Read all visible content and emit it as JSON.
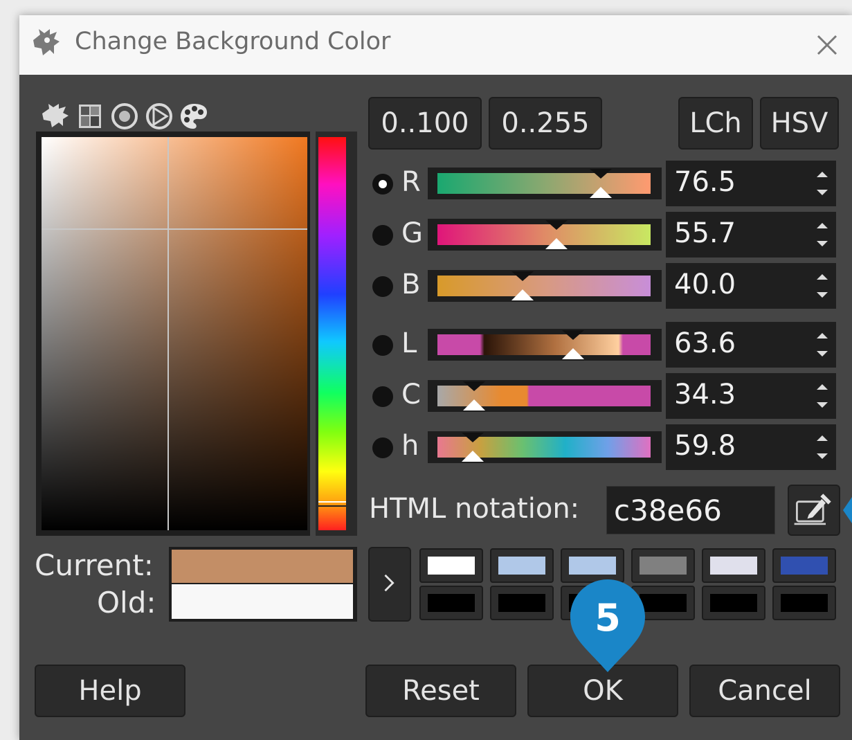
{
  "window": {
    "title": "Change Background Color",
    "close_icon": "close-icon",
    "app_icon": "gimp-icon"
  },
  "selector_tabs": [
    "gimp-selector-icon",
    "cmyk-selector-icon",
    "watercolor-selector-icon",
    "triangle-selector-icon",
    "palette-selector-icon"
  ],
  "range_buttons": {
    "percent": "0..100",
    "byte": "0..255"
  },
  "mode_buttons": {
    "lch": "LCh",
    "hsv": "HSV"
  },
  "channels": [
    {
      "label": "R",
      "value": "76.5",
      "selected": true,
      "position": 0.765
    },
    {
      "label": "G",
      "value": "55.7",
      "selected": false,
      "position": 0.557
    },
    {
      "label": "B",
      "value": "40.0",
      "selected": false,
      "position": 0.4
    },
    {
      "label": "L",
      "value": "63.6",
      "selected": false,
      "position": 0.636
    },
    {
      "label": "C",
      "value": "34.3",
      "selected": false,
      "position": 0.172
    },
    {
      "label": "h",
      "value": "59.8",
      "selected": false,
      "position": 0.166
    }
  ],
  "html_notation": {
    "label": "HTML notation:",
    "value": "c38e66",
    "eyedropper_icon": "eyedropper-icon"
  },
  "current": {
    "label": "Current:",
    "color": "#c38e66"
  },
  "old": {
    "label": "Old:",
    "color": "#f8f8f8"
  },
  "history_arrow": ">",
  "history_colors": [
    [
      "#ffffff",
      "#b0c8e8",
      "#b0c8e8",
      "#808080",
      "#e0e0ec",
      "#3050b0"
    ],
    [
      "#000000",
      "#000000",
      "#000000",
      "#000000",
      "#000000",
      "#000000"
    ]
  ],
  "buttons": {
    "help": "Help",
    "reset": "Reset",
    "ok": "OK",
    "cancel": "Cancel"
  },
  "callout": {
    "number": "5",
    "color": "#1a86c8"
  }
}
